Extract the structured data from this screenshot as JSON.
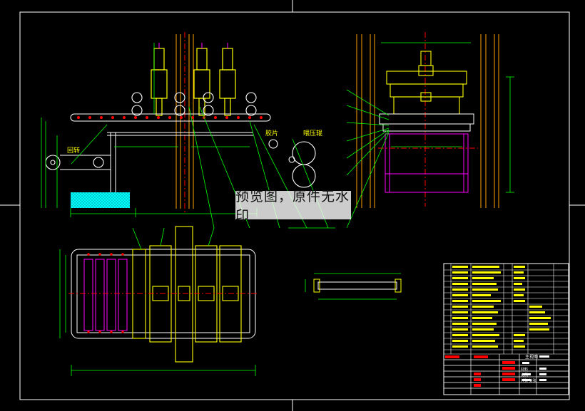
{
  "watermark": "预览图，原件无水印",
  "labels": {
    "return_station": "回转",
    "unwind": "胶片",
    "feed_roller": "喂压辊"
  },
  "title_block": {
    "drawing_name": "主视图",
    "material": "材料",
    "scale": "比例",
    "sheet": "共张 第张"
  },
  "colors": {
    "background": "#000000",
    "frame": "#ffffff",
    "green": "#00ff00",
    "yellow": "#ffff00",
    "magenta": "#ff00ff",
    "cyan": "#00ffff",
    "red": "#ff0000",
    "orange": "#ffa500"
  }
}
